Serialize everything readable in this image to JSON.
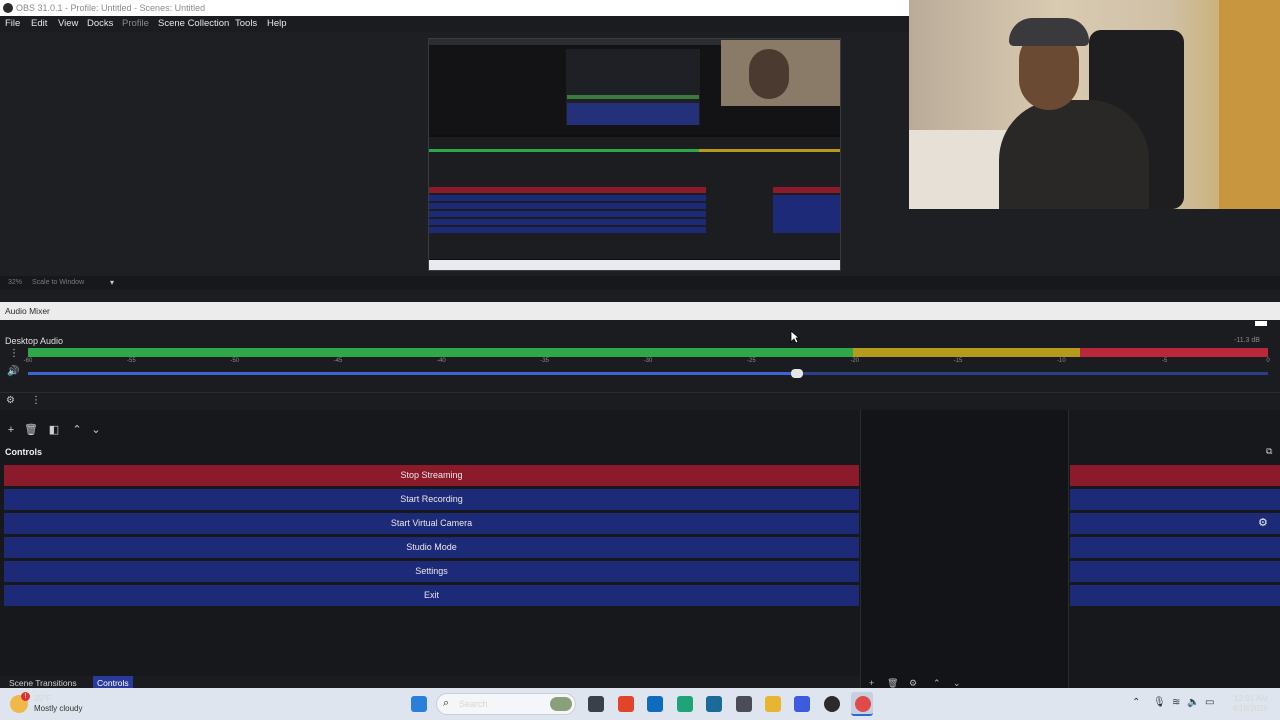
{
  "window": {
    "title": "OBS 31.0.1 - Profile: Untitled - Scenes: Untitled"
  },
  "menu": [
    "File",
    "Edit",
    "View",
    "Docks",
    "Profile",
    "Scene Collection",
    "Tools",
    "Help"
  ],
  "preview": {
    "zoom": "32%",
    "scale_mode": "Scale to Window"
  },
  "audio_mixer": {
    "title": "Audio Mixer",
    "channel": {
      "name": "Desktop Audio",
      "level": "-11.3 dB",
      "fader_fraction": 0.62
    },
    "ticks": [
      "-60",
      "-55",
      "-50",
      "-45",
      "-40",
      "-35",
      "-30",
      "-25",
      "-20",
      "-15",
      "-10",
      "-5",
      "0"
    ]
  },
  "controls": {
    "title": "Controls",
    "buttons": [
      "Stop Streaming",
      "Start Recording",
      "Start Virtual Camera",
      "Studio Mode",
      "Settings",
      "Exit"
    ]
  },
  "bottom_tabs": [
    "Scene Transitions",
    "Controls"
  ],
  "taskbar": {
    "weather_temp": "35°F",
    "weather_desc": "Mostly cloudy",
    "weather_badge": "!",
    "search_placeholder": "Search",
    "time": "12:01 AM",
    "date": "4/18/2026"
  },
  "colors": {
    "stop_red": "#8b1a2a",
    "button_blue": "#1d2a78",
    "meter_green": "#2fa84a",
    "meter_yellow": "#b59a1c",
    "meter_red": "#b8283a"
  }
}
